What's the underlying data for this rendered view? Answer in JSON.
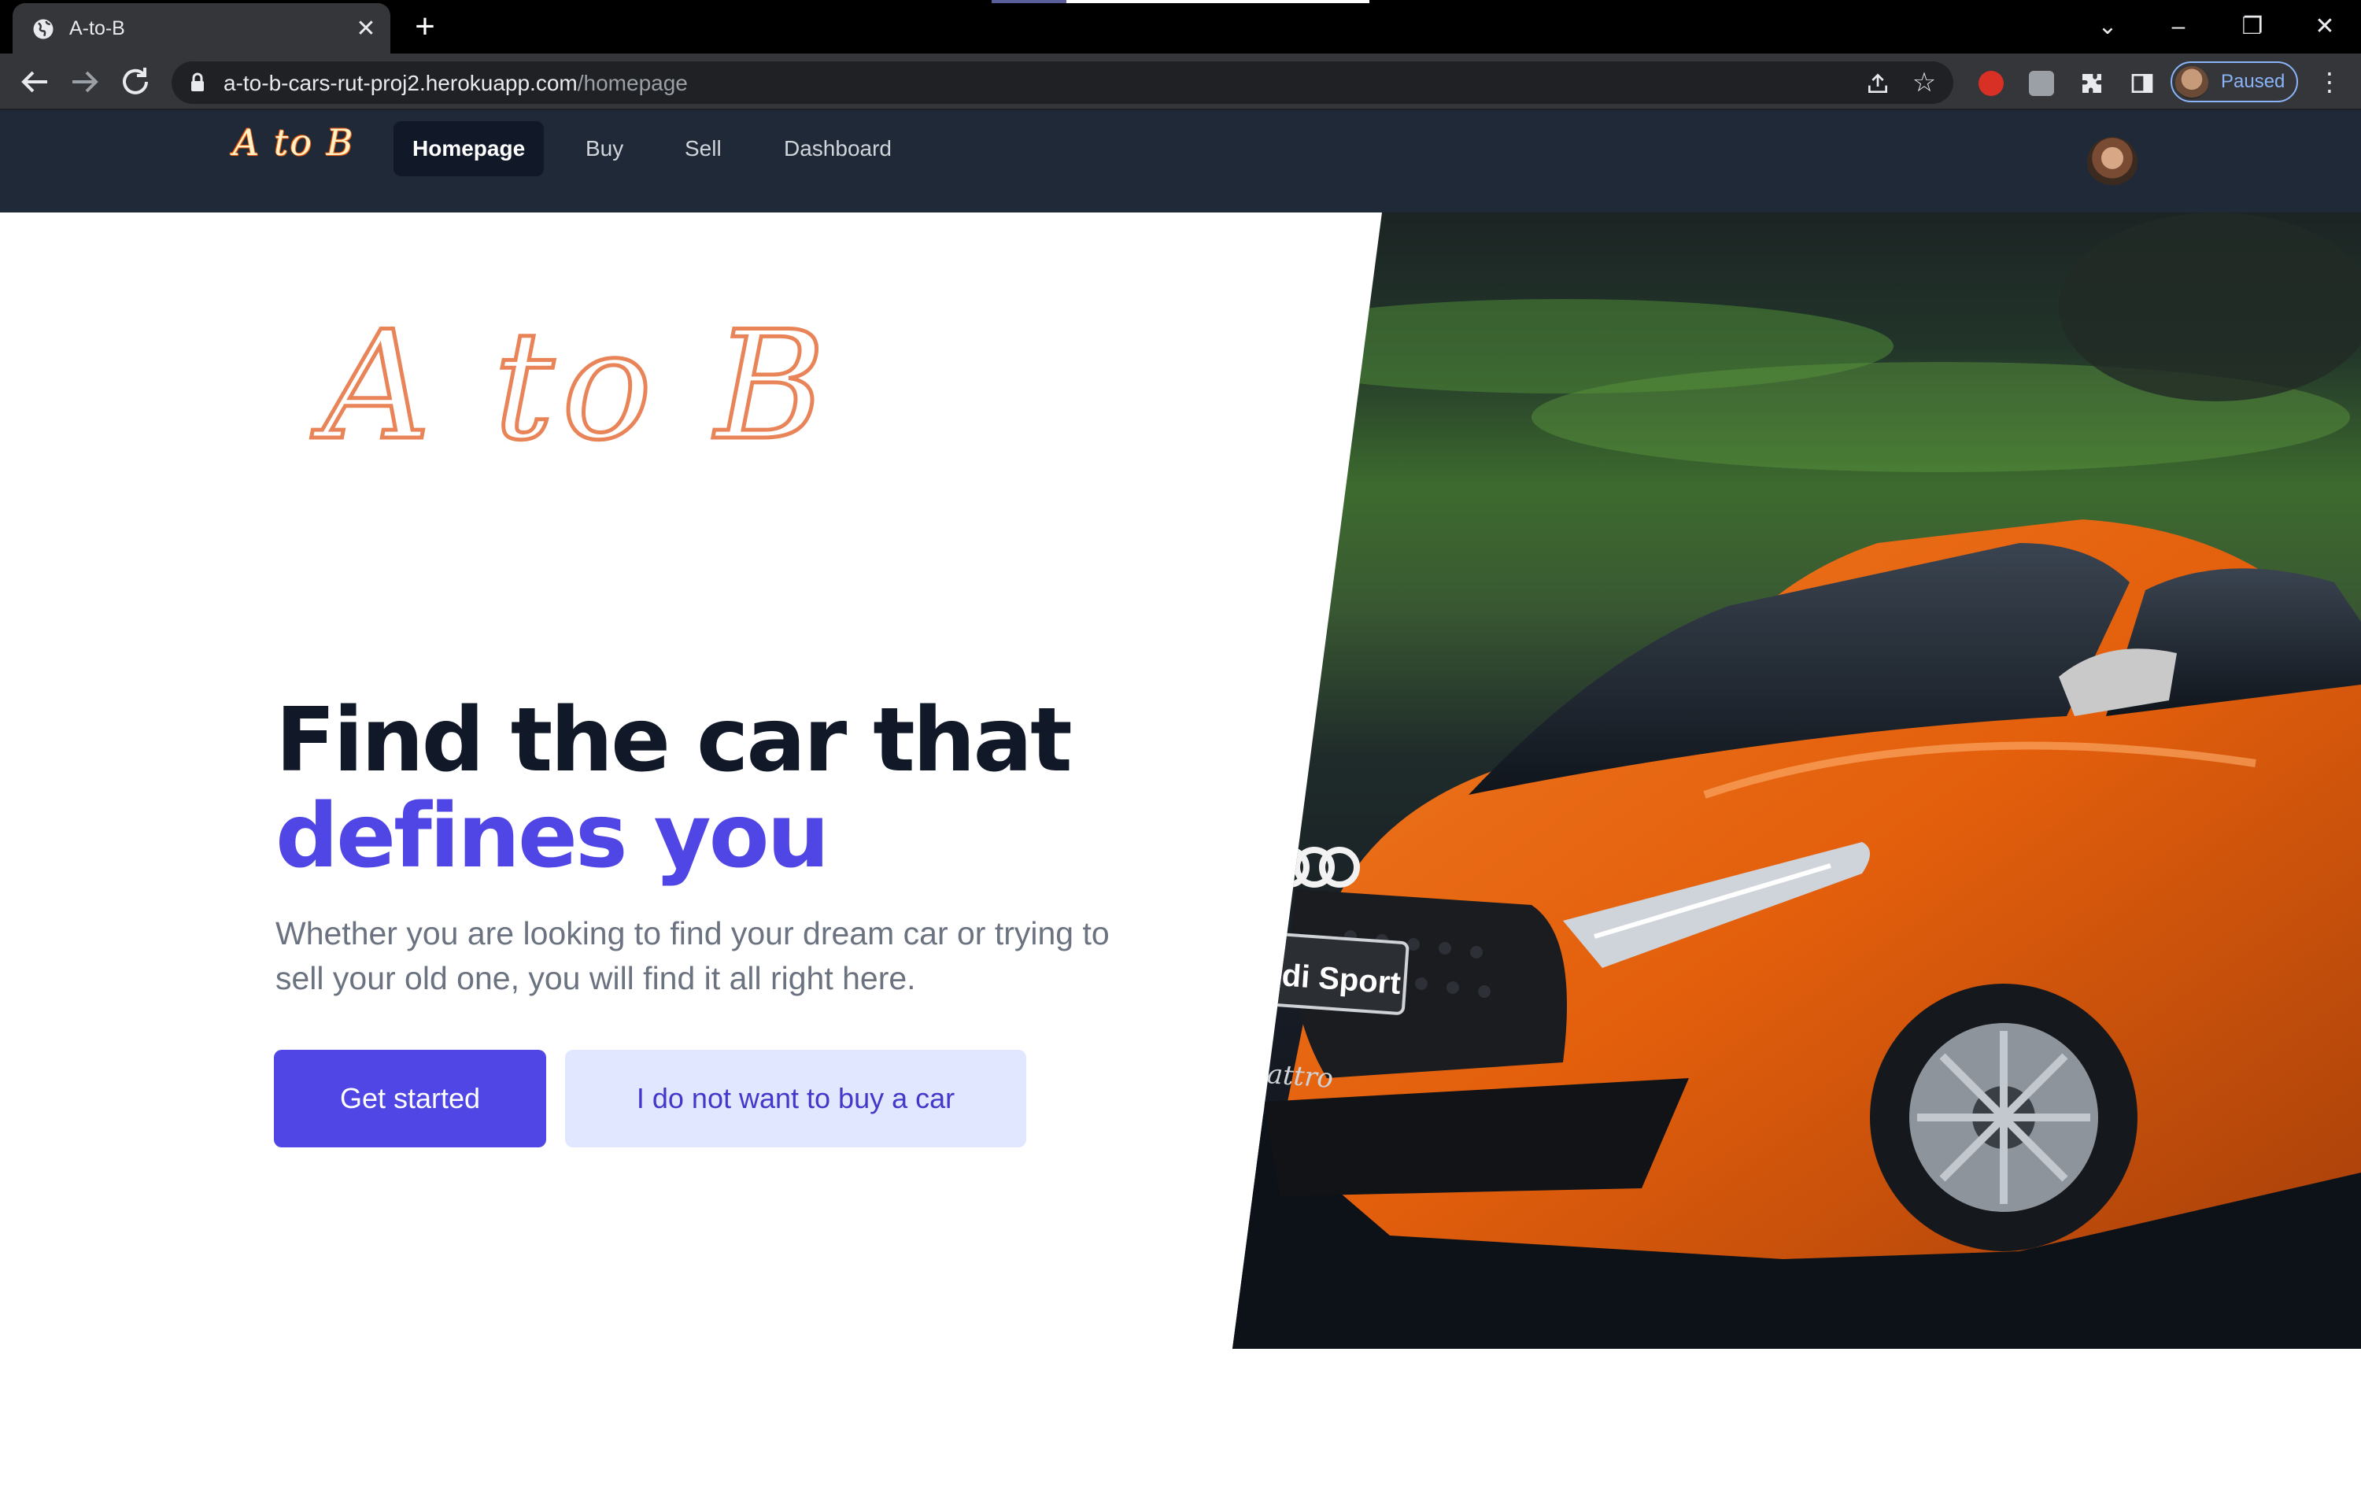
{
  "browser": {
    "tab_title": "A-to-B",
    "new_tab_symbol": "+",
    "url_host": "a-to-b-cars-rut-proj2.herokuapp.com",
    "url_path": "/homepage",
    "profile_status": "Paused"
  },
  "nav": {
    "brand": "A to B",
    "links": [
      {
        "label": "Homepage",
        "active": true
      },
      {
        "label": "Buy",
        "active": false
      },
      {
        "label": "Sell",
        "active": false
      },
      {
        "label": "Dashboard",
        "active": false
      }
    ]
  },
  "hero": {
    "logo_text": "A to B",
    "headline_line1": "Find the car that",
    "headline_line2": "defines you",
    "subtext": "Whether you are looking to find your dream car or trying to sell your old one, you will find it all right here.",
    "primary_button": "Get started",
    "secondary_button": "I do not want to buy a car",
    "image_plate_text": "Audi Sport",
    "image_grille_text": "quattro"
  },
  "colors": {
    "nav_bg": "#1f2937",
    "accent": "#4f46e5",
    "secondary_bg": "#e0e7ff",
    "car": "#e8650f"
  }
}
